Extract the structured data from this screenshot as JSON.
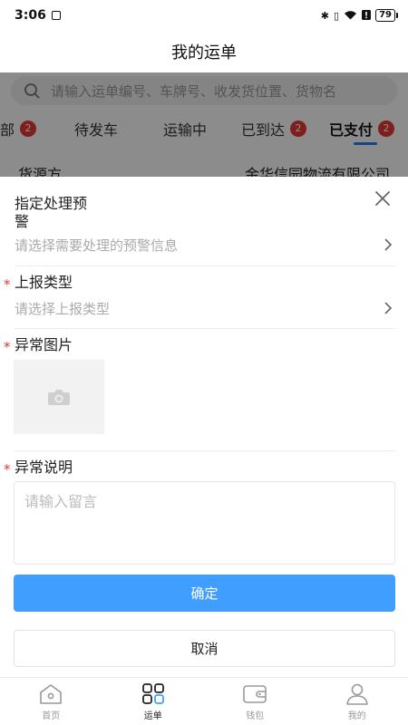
{
  "status_bar": {
    "time": "3:06",
    "battery": "79"
  },
  "header": {
    "title": "我的运单"
  },
  "background": {
    "search_placeholder": "请输入运单编号、车牌号、收发货位置、货物名",
    "tabs": [
      {
        "label": "部",
        "badge": "2"
      },
      {
        "label": "待发车",
        "badge": ""
      },
      {
        "label": "运输中",
        "badge": ""
      },
      {
        "label": "已到达",
        "badge": "2"
      },
      {
        "label": "已支付",
        "badge": "2"
      }
    ],
    "row_label": "货源方",
    "row_value": "金华信园物流有限公司"
  },
  "sheet": {
    "warning_label_line1": "指定处理预",
    "warning_label_line2": "警",
    "warning_placeholder": "请选择需要处理的预警信息",
    "required_mark": "*",
    "report_type_label": "上报类型",
    "report_type_placeholder": "请选择上报类型",
    "image_label": "异常图片",
    "desc_label": "异常说明",
    "desc_placeholder": "请输入留言",
    "confirm_label": "确定",
    "cancel_label": "取消",
    "colors": {
      "primary": "#409eff",
      "required": "#e53935"
    }
  },
  "bottom_nav": {
    "items": [
      {
        "label": "首页",
        "icon": "home-icon"
      },
      {
        "label": "运单",
        "icon": "orders-icon",
        "active": true
      },
      {
        "label": "钱包",
        "icon": "wallet-icon"
      },
      {
        "label": "我的",
        "icon": "profile-icon"
      }
    ]
  }
}
